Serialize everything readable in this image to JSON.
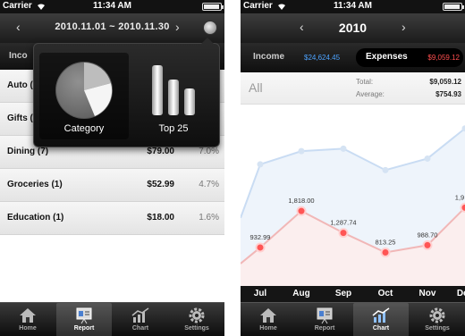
{
  "status": {
    "carrier": "Carrier",
    "time": "11:34 AM"
  },
  "left": {
    "range": {
      "prev": "‹",
      "label": "2010.11.01 ~ 2010.11.30",
      "next": "›"
    },
    "subhead_income": "Inco",
    "popover": {
      "category_label": "Category",
      "top_label": "Top 25"
    },
    "rows": [
      {
        "name": "Auto (",
        "amount": "",
        "pct": ""
      },
      {
        "name": "Gifts (",
        "amount": "",
        "pct": ""
      },
      {
        "name": "Dining (7)",
        "amount": "$79.00",
        "pct": "7.0%"
      },
      {
        "name": "Groceries (1)",
        "amount": "$52.99",
        "pct": "4.7%"
      },
      {
        "name": "Education (1)",
        "amount": "$18.00",
        "pct": "1.6%"
      }
    ],
    "tabs": [
      {
        "label": "Home",
        "icon": "home-icon"
      },
      {
        "label": "Report",
        "icon": "report-icon"
      },
      {
        "label": "Chart",
        "icon": "chart-icon"
      },
      {
        "label": "Settings",
        "icon": "gear-icon"
      }
    ],
    "active_tab": "Report"
  },
  "right": {
    "year": {
      "prev": "‹",
      "label": "2010",
      "next": "›"
    },
    "segment": {
      "income_label": "Income",
      "income_value": "$24,624.45",
      "expenses_label": "Expenses",
      "expenses_value": "$9,059.12"
    },
    "summary": {
      "filter": "All",
      "total_label": "Total:",
      "total_value": "$9,059.12",
      "average_label": "Average:",
      "average_value": "$754.93"
    },
    "tabs": [
      {
        "label": "Home",
        "icon": "home-icon"
      },
      {
        "label": "Report",
        "icon": "report-icon"
      },
      {
        "label": "Chart",
        "icon": "chart-icon"
      },
      {
        "label": "Settings",
        "icon": "gear-icon"
      }
    ],
    "active_tab": "Chart"
  },
  "colors": {
    "income": "#4da3ff",
    "expense": "#ff4f4f"
  },
  "chart_data": {
    "type": "line",
    "categories": [
      "Jul",
      "Aug",
      "Sep",
      "Oct",
      "Nov",
      "Dec"
    ],
    "series": [
      {
        "values": [
          932.99,
          1818.0,
          1287.74,
          813.25,
          988.7,
          1900
        ],
        "labels": [
          "932.99",
          "1,818.00",
          "1,287.74",
          "813.25",
          "988.70",
          "1,9"
        ]
      },
      {
        "values": [
          2950,
          3270,
          3330,
          2810,
          3090,
          3820
        ]
      }
    ],
    "ylim": [
      0,
      4400
    ],
    "grid": false
  }
}
